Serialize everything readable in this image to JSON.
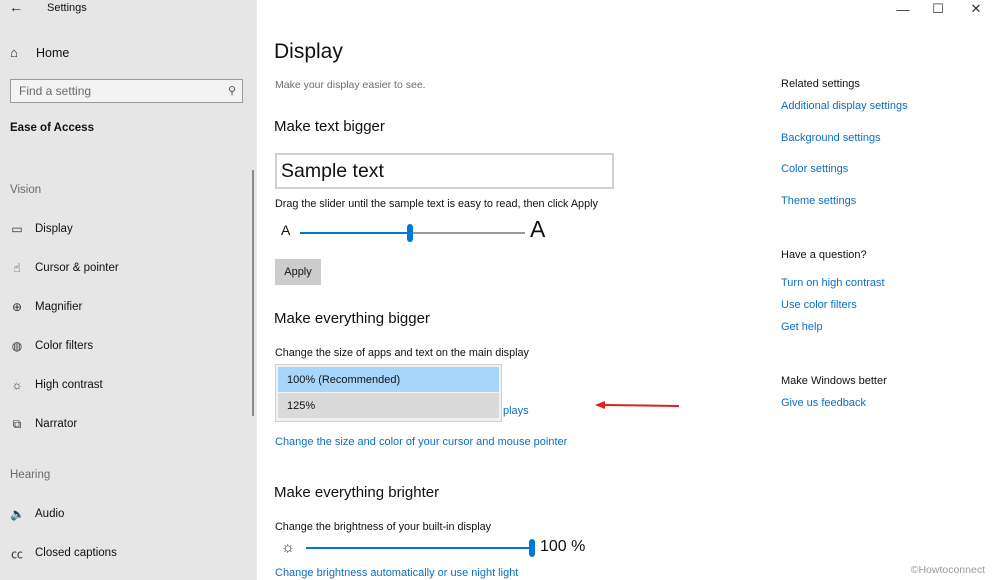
{
  "window": {
    "title": "Settings",
    "back_icon": "←",
    "minimize_icon": "—",
    "maximize_icon": "☐",
    "close_icon": "✕"
  },
  "sidebar": {
    "home": {
      "label": "Home",
      "icon": "⌂"
    },
    "search": {
      "placeholder": "Find a setting",
      "value": "",
      "icon": "⚲"
    },
    "section": "Ease of Access",
    "groups": [
      {
        "label": "Vision",
        "items": [
          {
            "label": "Display",
            "icon": "▭"
          },
          {
            "label": "Cursor & pointer",
            "icon": "☝"
          },
          {
            "label": "Magnifier",
            "icon": "⊕"
          },
          {
            "label": "Color filters",
            "icon": "◍"
          },
          {
            "label": "High contrast",
            "icon": "☼"
          },
          {
            "label": "Narrator",
            "icon": "⧉"
          }
        ]
      },
      {
        "label": "Hearing",
        "items": [
          {
            "label": "Audio",
            "icon": "🔈"
          },
          {
            "label": "Closed captions",
            "icon": "㏄"
          }
        ]
      }
    ]
  },
  "main": {
    "title": "Display",
    "subtitle": "Make your display easier to see.",
    "text_bigger": {
      "heading": "Make text bigger",
      "sample": "Sample text",
      "instructions": "Drag the slider until the sample text is easy to read, then click Apply",
      "small_a": "A",
      "big_a": "A",
      "slider_fraction": 0.49,
      "apply_label": "Apply"
    },
    "everything_bigger": {
      "heading": "Make everything bigger",
      "desc": "Change the size of apps and text on the main display",
      "options": [
        "100% (Recommended)",
        "125%"
      ],
      "selected": "100% (Recommended)",
      "hovered": "125%",
      "partial_link_suffix": "plays",
      "cursor_link": "Change the size and color of your cursor and mouse pointer"
    },
    "everything_brighter": {
      "heading": "Make everything brighter",
      "desc": "Change the brightness of your built-in display",
      "brightness_value": 100,
      "brightness_label": "100 %",
      "night_light_link": "Change brightness automatically or use night light"
    }
  },
  "right": {
    "related": {
      "heading": "Related settings",
      "links": [
        "Additional display settings",
        "Background settings",
        "Color settings",
        "Theme settings"
      ]
    },
    "question": {
      "heading": "Have a question?",
      "links": [
        "Turn on high contrast",
        "Use color filters",
        "Get help"
      ]
    },
    "better": {
      "heading": "Make Windows better",
      "links": [
        "Give us feedback"
      ]
    }
  },
  "watermark": "©Howtoconnect",
  "colors": {
    "accent": "#0078d7",
    "link": "#0a6fc2",
    "sidebar_bg": "#e6e6e6",
    "dropdown_selected": "#a8d6fb",
    "annotation_arrow": "#e02020"
  }
}
